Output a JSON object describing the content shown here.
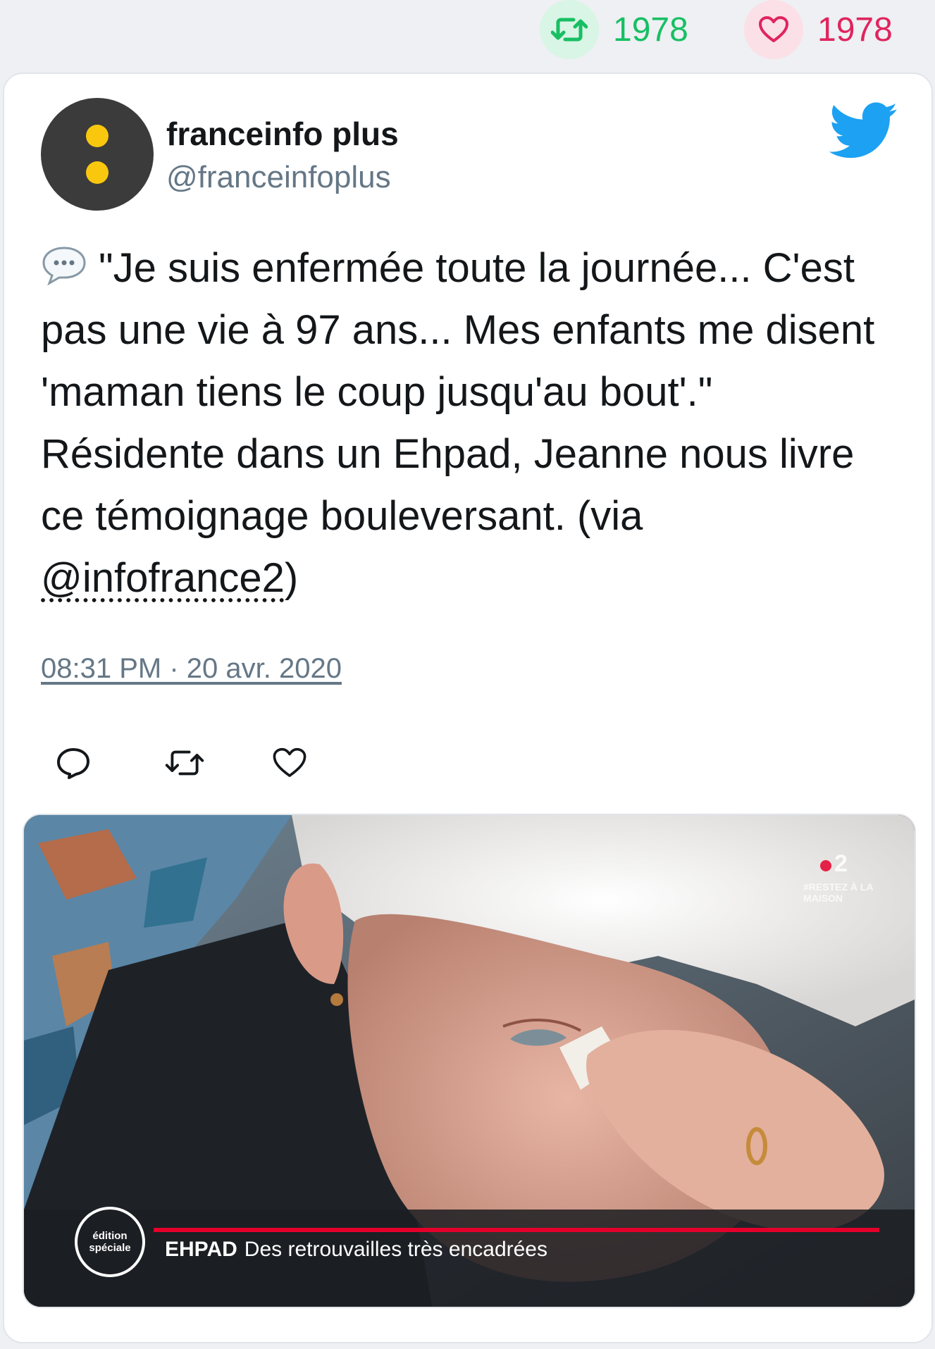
{
  "stats": {
    "retweet_count": "1978",
    "like_count": "1978",
    "retweet_icon": "retweet-icon",
    "like_icon": "heart-icon",
    "retweet_color": "#17bf63",
    "like_color": "#e0245e"
  },
  "author": {
    "name": "franceinfo plus",
    "handle": "@franceinfoplus",
    "avatar_icon": "franceinfo-dots-logo",
    "avatar_bg": "#3b3b3b",
    "avatar_dot_color": "#f9c80e"
  },
  "brand": {
    "icon": "twitter-bird-icon",
    "color": "#1da1f2"
  },
  "tweet": {
    "emoji_icon": "speech-balloon-icon",
    "text_before_mention": "\"Je suis enfermée toute la journée... C'est pas une vie à 97 ans... Mes enfants me disent 'maman tiens le coup jusqu'au bout'.\" Résidente dans un Ehpad, Jeanne nous livre ce témoignage bouleversant. (via ",
    "mention": "@infofrance2",
    "text_after_mention": ")",
    "timestamp": "08:31 PM · 20 avr. 2020"
  },
  "actions": [
    {
      "icon": "reply-icon"
    },
    {
      "icon": "retweet-icon"
    },
    {
      "icon": "heart-icon"
    }
  ],
  "media": {
    "edition_badge": "édition spéciale",
    "caption_tag": "EHPAD",
    "caption_text": "Des retrouvailles très encadrées",
    "channel_logo": "2",
    "channel_sub": "#RESTEZ À LA MAISON"
  }
}
